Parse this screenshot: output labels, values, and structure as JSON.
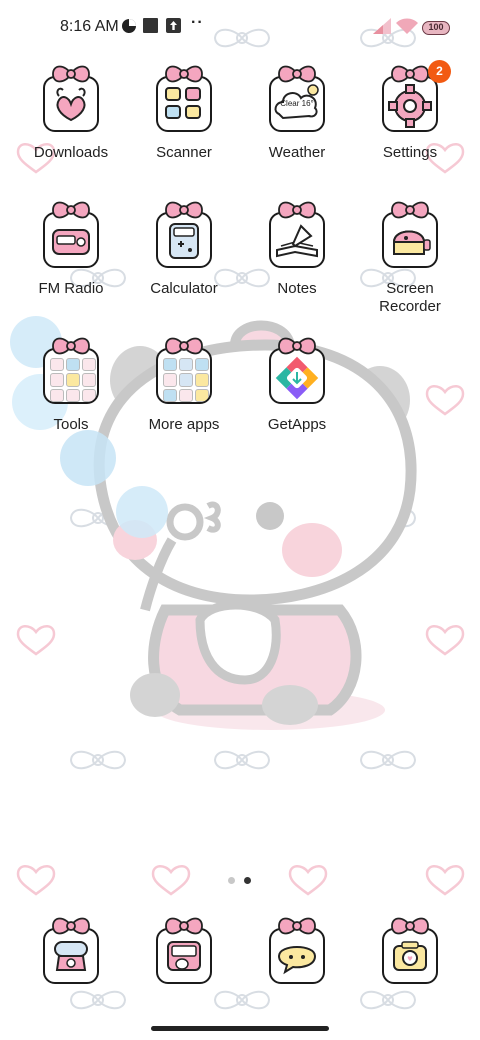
{
  "status_bar": {
    "time": "8:16 AM",
    "icons": [
      "data-saver-icon",
      "notification-square-icon",
      "upload-icon",
      "more-dots-icon",
      "signal-icon",
      "wifi-icon",
      "battery-icon"
    ],
    "dots": "··",
    "battery_level": "100"
  },
  "home": {
    "apps": [
      {
        "label": "Downloads",
        "icon": "downloads-icon"
      },
      {
        "label": "Scanner",
        "icon": "scanner-icon"
      },
      {
        "label": "Weather",
        "icon": "weather-icon",
        "tile_text": "Clear 16°"
      },
      {
        "label": "Settings",
        "icon": "settings-icon",
        "badge": "2"
      },
      {
        "label": "FM Radio",
        "icon": "radio-icon"
      },
      {
        "label": "Calculator",
        "icon": "calculator-icon"
      },
      {
        "label": "Notes",
        "icon": "notes-icon"
      },
      {
        "label": "Screen\nRecorder",
        "icon": "screen-recorder-icon"
      },
      {
        "label": "Tools",
        "icon": "tools-folder-icon"
      },
      {
        "label": "More apps",
        "icon": "more-apps-folder-icon"
      },
      {
        "label": "GetApps",
        "icon": "getapps-icon"
      }
    ]
  },
  "page_indicator": {
    "pages": 2,
    "active": 2
  },
  "dock": {
    "apps": [
      {
        "icon": "phone-dock-icon"
      },
      {
        "icon": "messages-dock-icon"
      },
      {
        "icon": "chat-dock-icon"
      },
      {
        "icon": "camera-dock-icon"
      }
    ]
  },
  "colors": {
    "bow_pink": "#f4a6bf",
    "badge_orange": "#f25a12",
    "heart_pink": "#f6c9d4",
    "panda_gray": "#c8c8c8",
    "panda_pink": "#f7d8e1",
    "bubble_blue": "#cfe9f8"
  }
}
